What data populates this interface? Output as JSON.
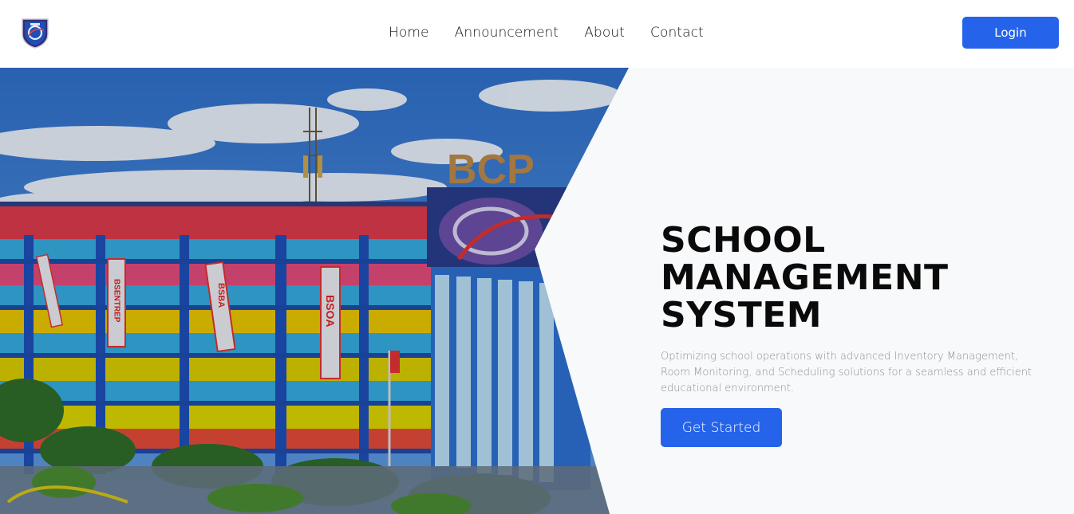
{
  "nav": {
    "links": [
      "Home",
      "Announcement",
      "About",
      "Contact"
    ],
    "login_label": "Login"
  },
  "hero": {
    "title": "SCHOOL MANAGEMENT SYSTEM",
    "description": "Optimizing school operations with advanced Inventory Management, Room Monitoring, and Scheduling solutions for a seamless and efficient educational environment.",
    "cta_label": "Get Started",
    "image": {
      "sign_text": "BCP",
      "banners": [
        "BSENTREP",
        "BSBA",
        "BSOA"
      ]
    }
  },
  "colors": {
    "primary": "#2563eb",
    "hero_bg": "#f8f9fb",
    "title": "#0a0a0a",
    "muted_text": "#8a8f98"
  },
  "icons": {
    "logo": "school-crest-icon"
  }
}
